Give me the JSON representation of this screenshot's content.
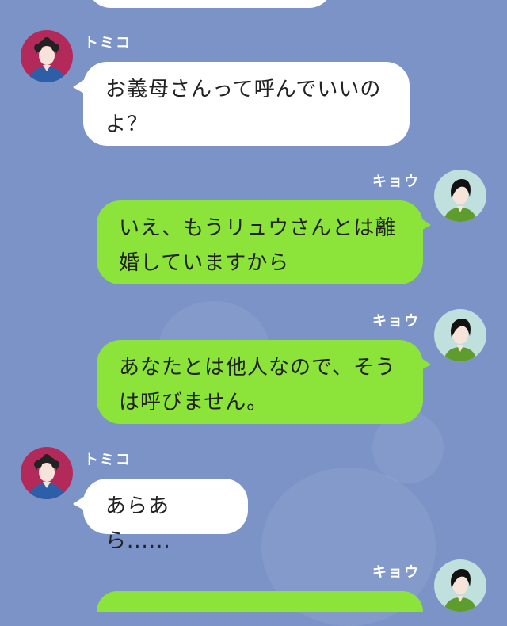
{
  "colors": {
    "background": "#7b93c6",
    "incoming_bubble": "#ffffff",
    "outgoing_bubble": "#8ce43a",
    "name_text": "#ffffff"
  },
  "messages": [
    {
      "sender": "トミコ",
      "side": "left",
      "lines": [
        "お義母さんって呼んでいいの",
        "よ？"
      ],
      "avatar": "tomiko-avatar"
    },
    {
      "sender": "キョウ",
      "side": "right",
      "lines": [
        "いえ、もうリュウさんとは離",
        "婚していますから"
      ],
      "avatar": "kyou-avatar"
    },
    {
      "sender": "キョウ",
      "side": "right",
      "lines": [
        "あなたとは他人なので、そう",
        "は呼びません。"
      ],
      "avatar": "kyou-avatar"
    },
    {
      "sender": "トミコ",
      "side": "left",
      "lines": [
        "あらあら......"
      ],
      "avatar": "tomiko-avatar"
    },
    {
      "sender": "キョウ",
      "side": "right",
      "lines": [],
      "avatar": "kyou-avatar"
    }
  ]
}
